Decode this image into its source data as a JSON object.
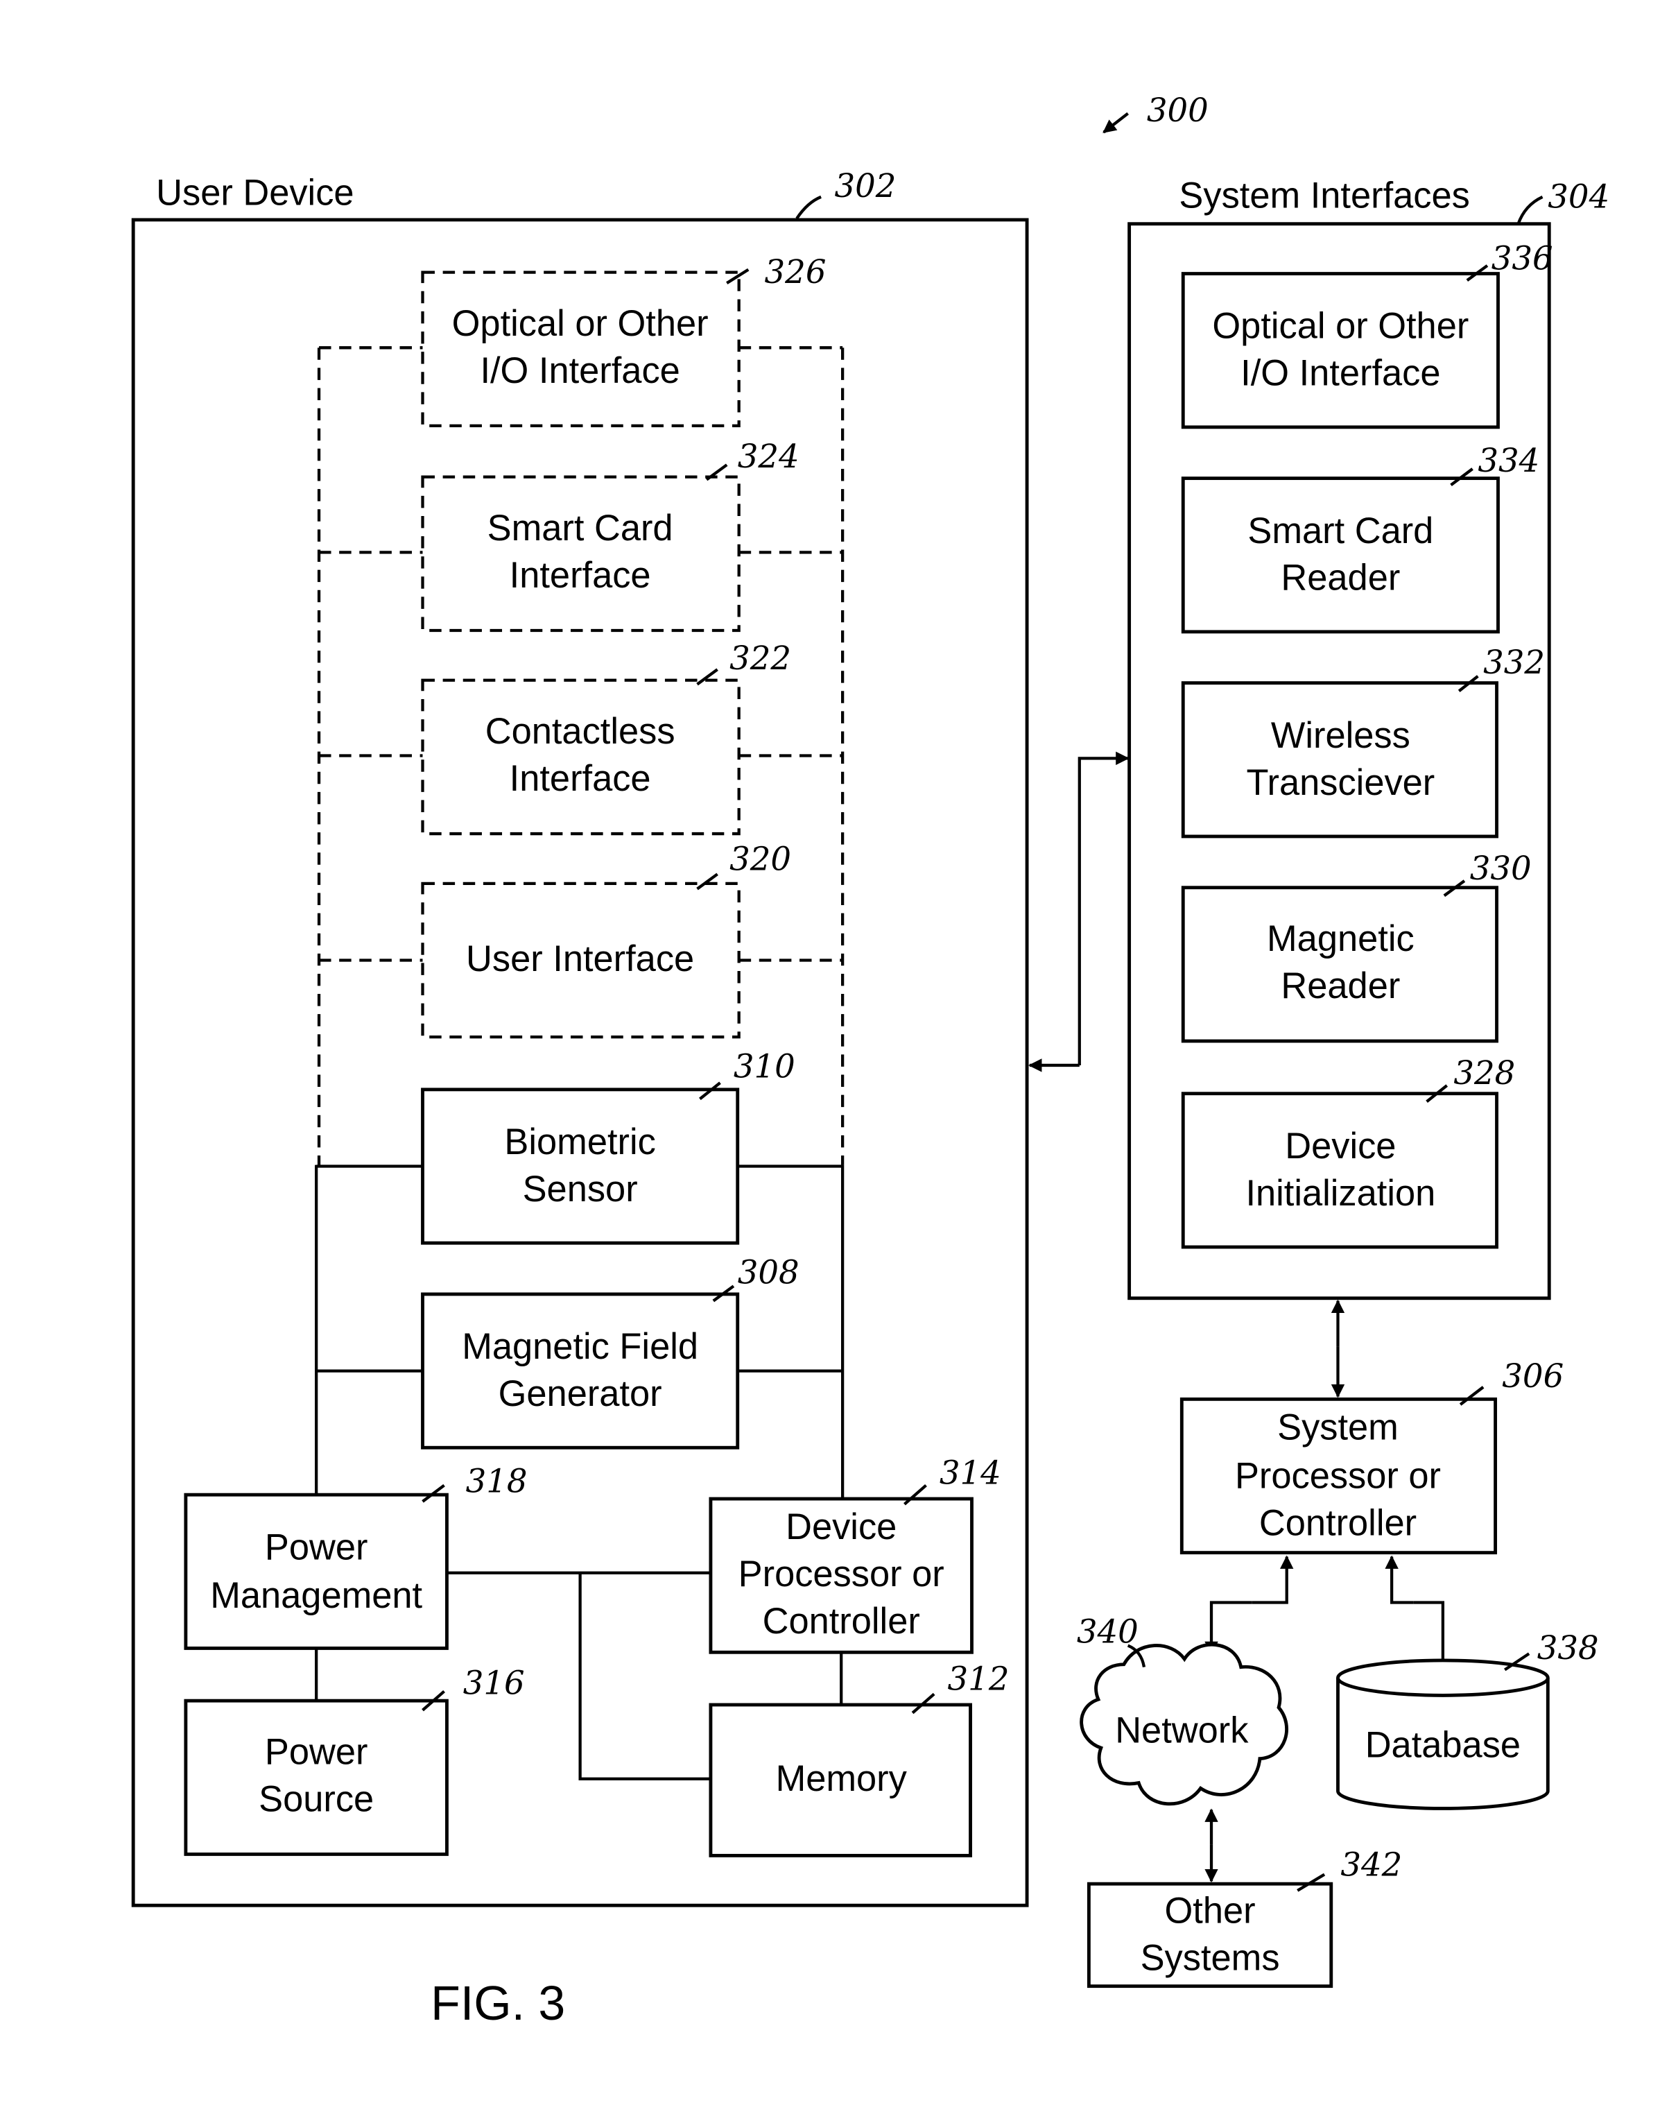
{
  "figure": {
    "ref": "300",
    "caption": "FIG. 3"
  },
  "user_device": {
    "title": "User Device",
    "ref": "302",
    "optional_blocks": [
      {
        "ref": "326",
        "lines": [
          "Optical or Other",
          "I/O Interface"
        ]
      },
      {
        "ref": "324",
        "lines": [
          "Smart Card",
          "Interface"
        ]
      },
      {
        "ref": "322",
        "lines": [
          "Contactless",
          "Interface"
        ]
      },
      {
        "ref": "320",
        "lines": [
          "User Interface"
        ]
      }
    ],
    "blocks": {
      "biometric": {
        "ref": "310",
        "lines": [
          "Biometric",
          "Sensor"
        ]
      },
      "magnetic_field": {
        "ref": "308",
        "lines": [
          "Magnetic Field",
          "Generator"
        ]
      },
      "power_management": {
        "ref": "318",
        "lines": [
          "Power",
          "Management"
        ]
      },
      "device_processor": {
        "ref": "314",
        "lines": [
          "Device",
          "Processor or",
          "Controller"
        ]
      },
      "power_source": {
        "ref": "316",
        "lines": [
          "Power",
          "Source"
        ]
      },
      "memory": {
        "ref": "312",
        "lines": [
          "Memory"
        ]
      }
    }
  },
  "system_interfaces": {
    "title": "System Interfaces",
    "ref": "304",
    "blocks": [
      {
        "ref": "336",
        "lines": [
          "Optical or Other",
          "I/O Interface"
        ]
      },
      {
        "ref": "334",
        "lines": [
          "Smart Card",
          "Reader"
        ]
      },
      {
        "ref": "332",
        "lines": [
          "Wireless",
          "Transciever"
        ]
      },
      {
        "ref": "330",
        "lines": [
          "Magnetic",
          "Reader"
        ]
      },
      {
        "ref": "328",
        "lines": [
          "Device",
          "Initialization"
        ]
      }
    ]
  },
  "system_processor": {
    "ref": "306",
    "lines": [
      "System",
      "Processor or",
      "Controller"
    ]
  },
  "network": {
    "ref": "340",
    "lines": [
      "Network"
    ]
  },
  "database": {
    "ref": "338",
    "lines": [
      "Database"
    ]
  },
  "other_systems": {
    "ref": "342",
    "lines": [
      "Other",
      "Systems"
    ]
  }
}
